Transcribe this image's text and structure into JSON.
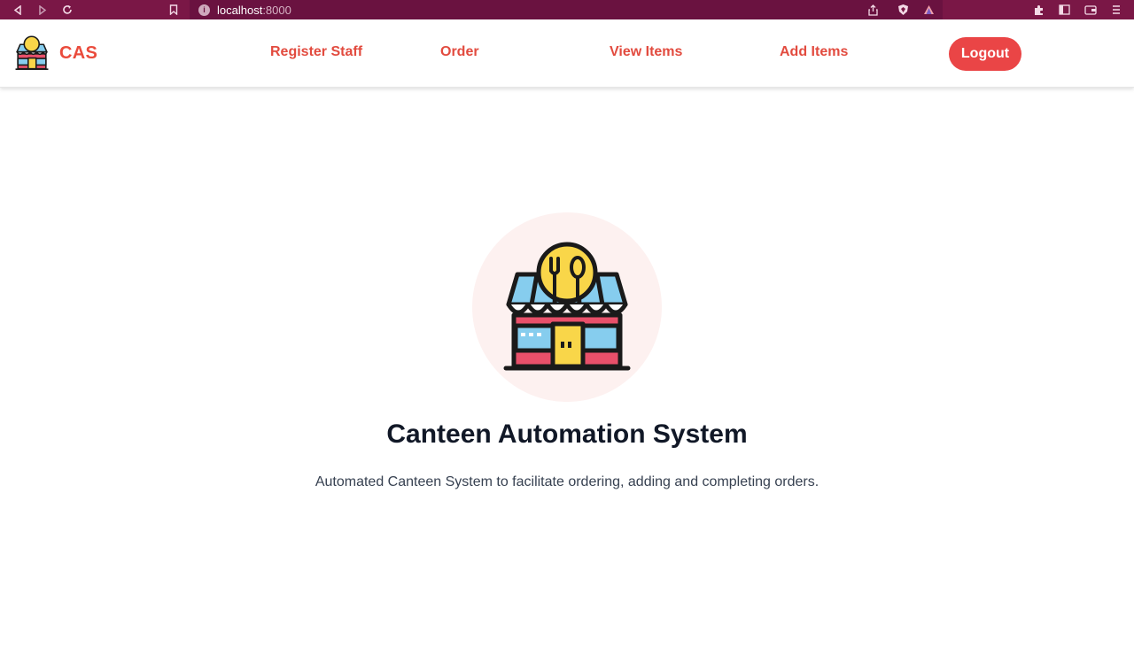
{
  "browser": {
    "url_host": "localhost",
    "url_port": ":8000",
    "info_glyph": "i",
    "icons": [
      "back-icon",
      "forward-icon",
      "reload-icon",
      "bookmark-icon",
      "share-icon",
      "brave-shield-icon",
      "rewards-icon",
      "extensions-icon",
      "sidebar-icon",
      "wallet-icon",
      "menu-icon"
    ]
  },
  "nav": {
    "brand": "CAS",
    "links": [
      "Register Staff",
      "Order",
      "View Items",
      "Add Items"
    ],
    "logout_label": "Logout"
  },
  "hero": {
    "title": "Canteen Automation System",
    "subtitle": "Automated Canteen System to facilitate ordering, adding and completing orders."
  },
  "colors": {
    "brand": "#ea4b3c",
    "logout_bg": "#ea4546",
    "chrome": "#7a1746",
    "hero_bg": "#fdf1f0"
  }
}
